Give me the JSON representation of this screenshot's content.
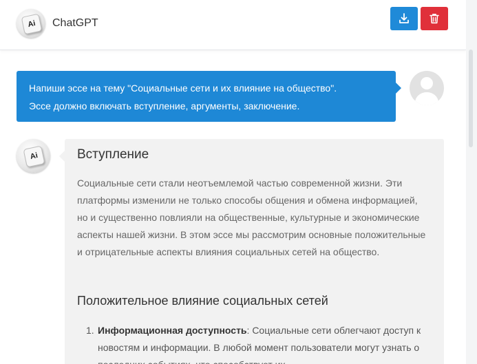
{
  "header": {
    "app_title": "ChatGPT",
    "avatar_label": "Ai",
    "download_icon": "download-icon",
    "delete_icon": "trash-icon",
    "colors": {
      "download": "#1f8ad8",
      "delete": "#e0303a"
    }
  },
  "messages": {
    "user": {
      "line1": "Напиши эссе на тему \"Социальные сети и их влияние на общество\".",
      "line2": "Эссе должно включать вступление, аргументы, заключение.",
      "bubble_color": "#1e88d6"
    },
    "assistant": {
      "avatar_label": "Ai",
      "intro_heading": "Вступление",
      "intro_text": "Социальные сети стали неотъемлемой частью современной жизни. Эти платформы изменили не только способы общения и обмена информацией, но и существенно повлияли на общественные, культурные и экономические аспекты нашей жизни. В этом эссе мы рассмотрим основные положительные и отрицательные аспекты влияния социальных сетей на общество.",
      "positive_heading": "Положительное влияние социальных сетей",
      "list": [
        {
          "number": "1.",
          "title": "Информационная доступность",
          "text": ": Социальные сети облегчают доступ к новостям и информации. В любой момент пользователи могут узнать о последних событиях, что способствует их"
        }
      ]
    }
  }
}
